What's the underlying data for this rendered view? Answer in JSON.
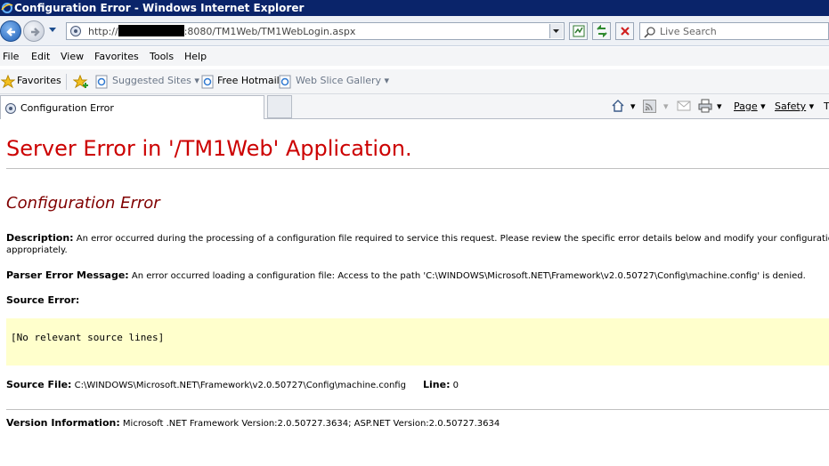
{
  "window": {
    "title": "Configuration Error - Windows Internet Explorer"
  },
  "address": {
    "url_prefix": "http://",
    "url_suffix": ":8080/TM1Web/TM1WebLogin.aspx"
  },
  "search": {
    "placeholder": "Live Search"
  },
  "menu": [
    "File",
    "Edit",
    "View",
    "Favorites",
    "Tools",
    "Help"
  ],
  "favorites": {
    "label": "Favorites",
    "items": [
      "Suggested Sites",
      "Free Hotmail",
      "Web Slice Gallery"
    ]
  },
  "tab": {
    "title": "Configuration Error"
  },
  "commands": {
    "page": "Page",
    "safety": "Safety",
    "tools_cut": "T"
  },
  "page": {
    "heading": "Server Error in '/TM1Web' Application.",
    "subheading": "Configuration Error",
    "description_label": "Description:",
    "description_text": " An error occurred during the processing of a configuration file required to service this request. Please review the specific error details below and modify your configuration file",
    "description_text2": "appropriately.",
    "parser_label": "Parser Error Message:",
    "parser_text": " An error occurred loading a configuration file: Access to the path 'C:\\WINDOWS\\Microsoft.NET\\Framework\\v2.0.50727\\Config\\machine.config' is denied.",
    "source_error_label": "Source Error:",
    "source_lines": "[No relevant source lines]",
    "source_file_label": "Source File:",
    "source_file_text": " C:\\WINDOWS\\Microsoft.NET\\Framework\\v2.0.50727\\Config\\machine.config",
    "line_label": "Line:",
    "line_value": " 0",
    "version_label": "Version Information:",
    "version_text": " Microsoft .NET Framework Version:2.0.50727.3634; ASP.NET Version:2.0.50727.3634"
  }
}
